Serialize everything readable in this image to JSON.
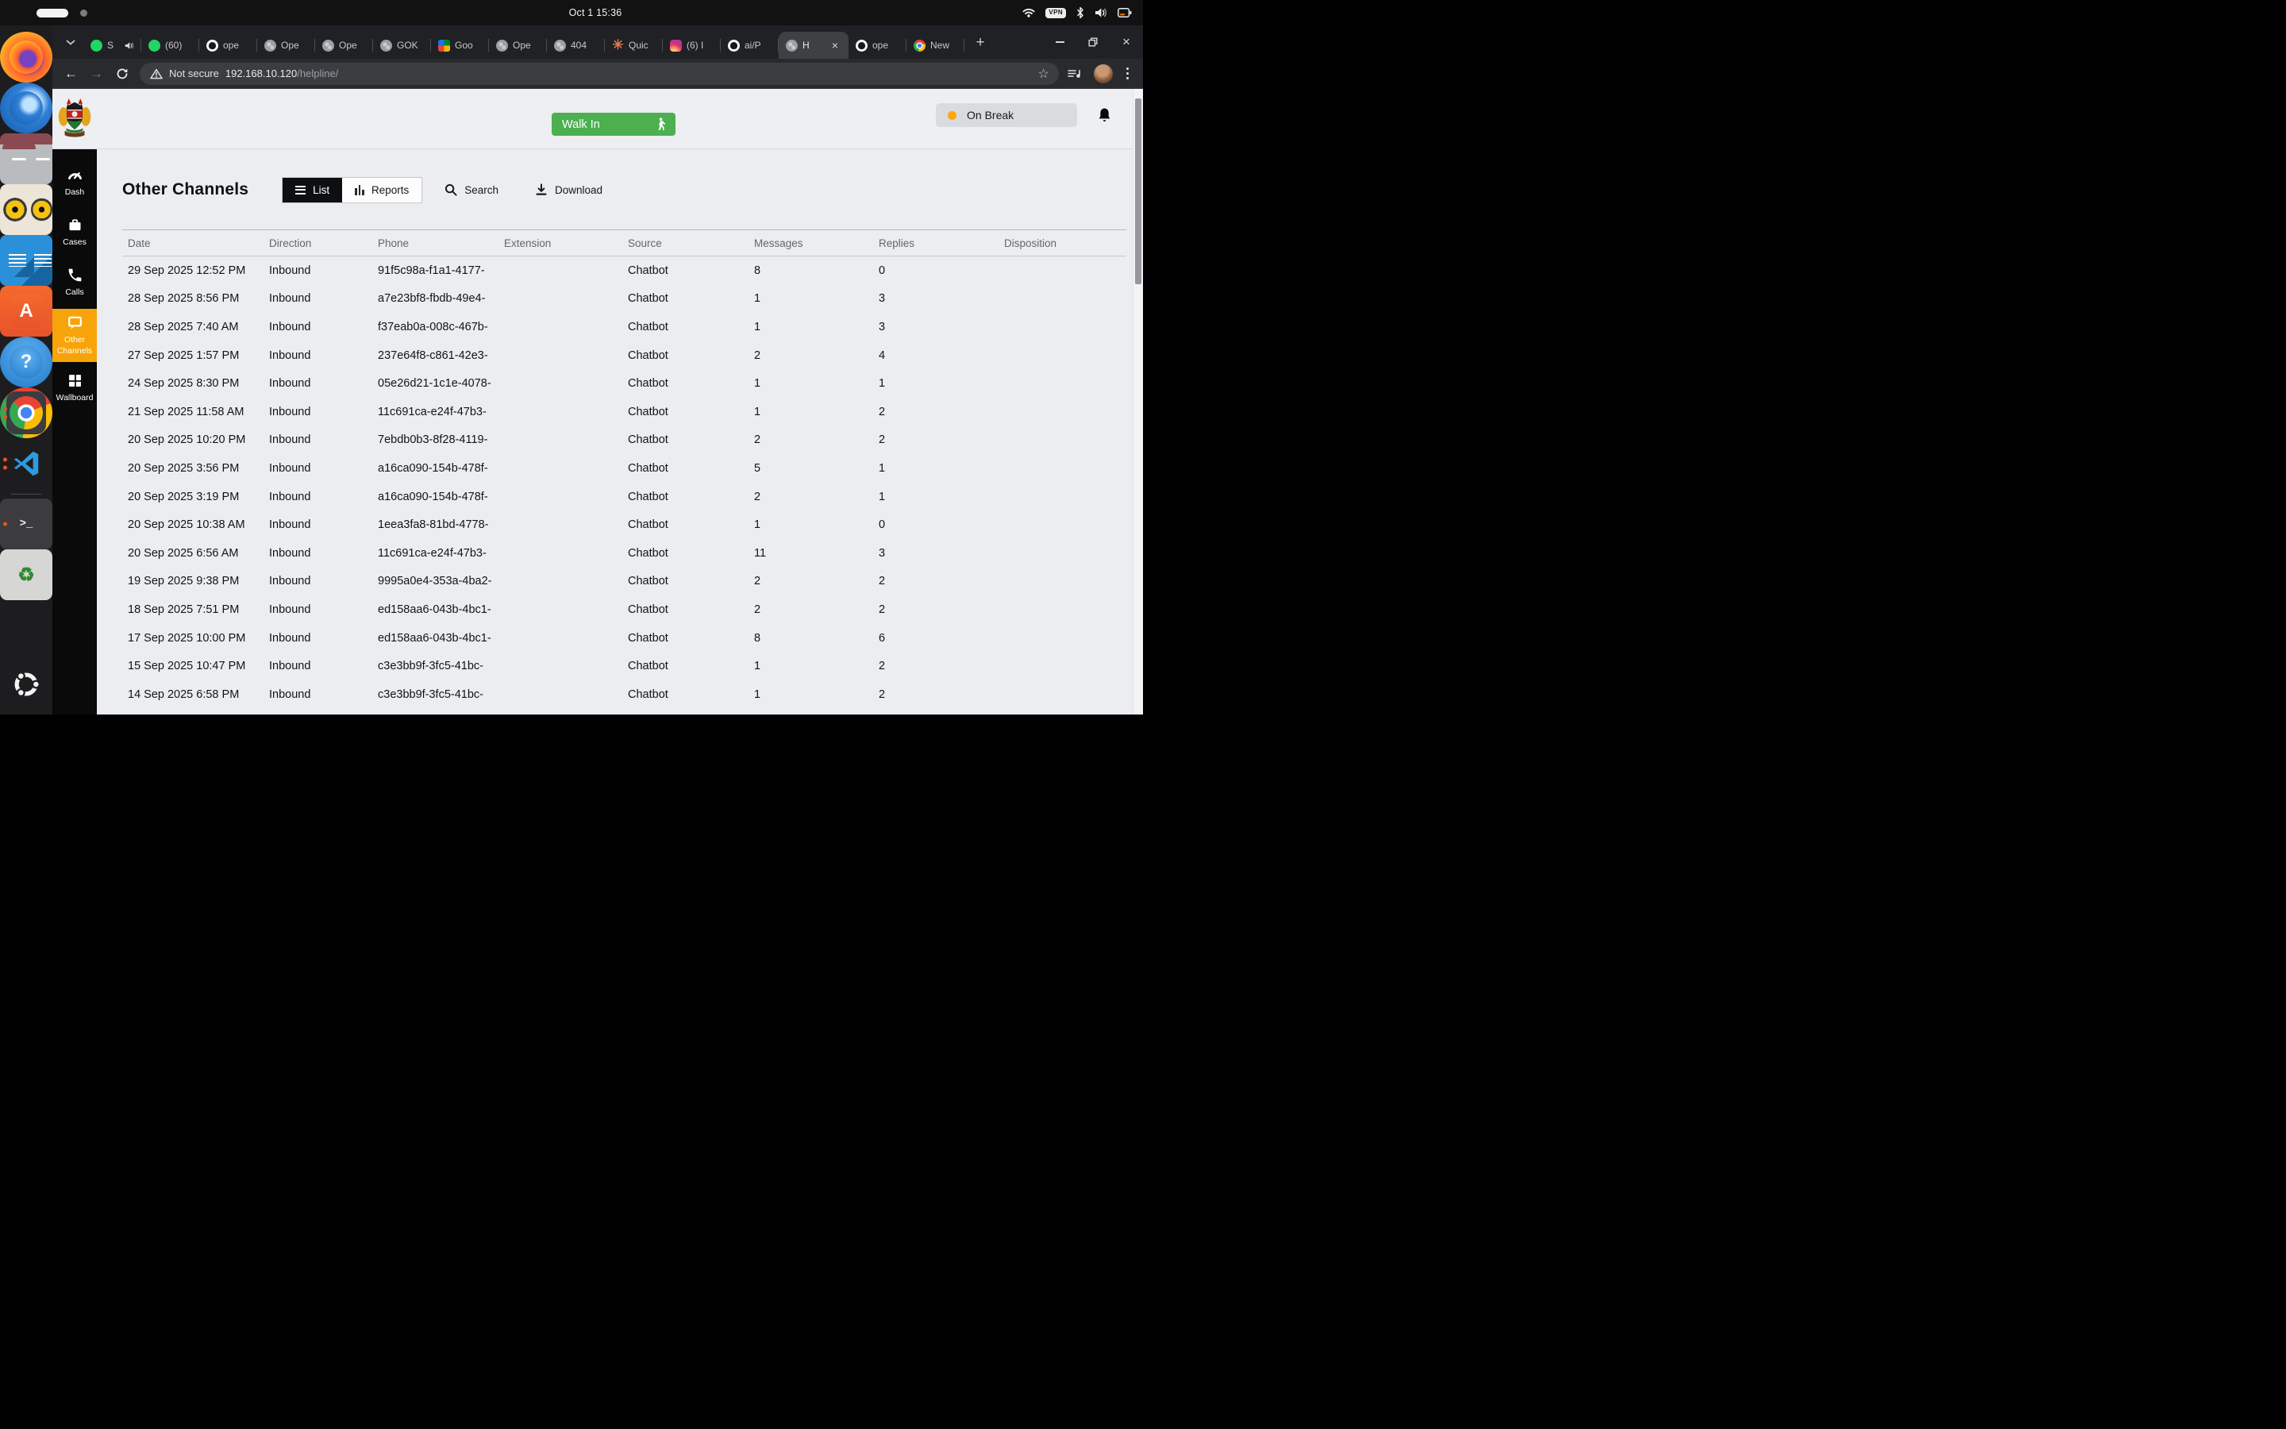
{
  "colors": {
    "accent_orange": "#F7A40A",
    "walkin_green": "#4CAF50",
    "status_dot_orange": "#FFA60A",
    "dock_running_dot": "#E95420"
  },
  "system_bar": {
    "clock": "Oct 1 15:36",
    "vpn_label": "VPN"
  },
  "dock": {
    "items": [
      {
        "name": "Firefox",
        "icon": "firefox",
        "icon_name": "firefox-icon",
        "dots": 0,
        "glyph": ""
      },
      {
        "name": "Thunderbird",
        "icon": "thunderbird",
        "icon_name": "thunderbird-icon",
        "dots": 0,
        "glyph": ""
      },
      {
        "name": "Files",
        "icon": "files",
        "icon_name": "files-icon",
        "dots": 1,
        "glyph": ""
      },
      {
        "name": "Rhythmbox",
        "icon": "rhythmbox",
        "icon_name": "rhythmbox-icon",
        "dots": 0,
        "glyph": ""
      },
      {
        "name": "LibreOffice",
        "icon": "libreoffice",
        "icon_name": "libreoffice-writer-icon",
        "dots": 0,
        "glyph": ""
      },
      {
        "name": "App Center",
        "icon": "appcenter",
        "icon_name": "app-center-icon",
        "dots": 0,
        "glyph": "A"
      },
      {
        "name": "Help",
        "icon": "help",
        "icon_name": "help-icon",
        "dots": 0,
        "glyph": "?"
      },
      {
        "name": "Google Chrome",
        "icon": "chrome",
        "icon_name": "chrome-icon",
        "dots": 2,
        "active": true,
        "glyph": ""
      },
      {
        "name": "VS Code",
        "icon": "vscode",
        "icon_name": "vscode-icon",
        "dots": 2,
        "glyph": ""
      },
      {
        "icon": "divider",
        "icon_name": "dock-divider",
        "glyph": ""
      },
      {
        "name": "Terminal",
        "icon": "terminal",
        "icon_name": "terminal-icon",
        "dots": 1,
        "glyph": ">_"
      },
      {
        "name": "Trash",
        "icon": "trash",
        "icon_name": "trash-icon",
        "dots": 0,
        "glyph": "♻"
      },
      {
        "name": "Ubuntu",
        "icon": "ubuntu",
        "icon_name": "ubuntu-logo-icon",
        "dots": 0,
        "push": true,
        "glyph": ""
      }
    ]
  },
  "browser": {
    "tabs": [
      {
        "icon": "spotify",
        "icon_name": "spotify-icon",
        "label": "S",
        "audio": true
      },
      {
        "icon": "whatsapp",
        "icon_name": "whatsapp-icon",
        "label": "(60)"
      },
      {
        "icon": "github",
        "icon_name": "github-icon",
        "label": "ope"
      },
      {
        "icon": "globe",
        "icon_name": "globe-icon",
        "label": "Ope"
      },
      {
        "icon": "globe",
        "icon_name": "globe-icon",
        "label": "Ope"
      },
      {
        "icon": "globe",
        "icon_name": "globe-icon",
        "label": "GOK"
      },
      {
        "icon": "meet",
        "icon_name": "google-meet-icon",
        "label": "Goo"
      },
      {
        "icon": "globe",
        "icon_name": "globe-icon",
        "label": "Ope"
      },
      {
        "icon": "globe",
        "icon_name": "globe-icon",
        "label": "404"
      },
      {
        "icon": "claude",
        "icon_name": "claude-icon",
        "label": "Quic",
        "glyph": "✳"
      },
      {
        "icon": "instagram",
        "icon_name": "instagram-icon",
        "label": "(6) I"
      },
      {
        "icon": "github",
        "icon_name": "github-icon",
        "label": "ai/P"
      },
      {
        "icon": "globe",
        "icon_name": "globe-icon",
        "label": "H",
        "active": true,
        "closable": true
      },
      {
        "icon": "github",
        "icon_name": "github-icon",
        "label": "ope"
      },
      {
        "icon": "chrome",
        "icon_name": "chrome-icon",
        "label": "New"
      }
    ],
    "new_tab_label": "+",
    "toolbar": {
      "not_secure_label": "Not secure",
      "url_host": "192.168.10.120",
      "url_path": "/helpline/"
    }
  },
  "app": {
    "header": {
      "walk_in_label": "Walk In",
      "status_label": "On Break"
    },
    "sidebar": {
      "items": [
        {
          "label": "Dash",
          "icon_ref": "#i-dash",
          "icon_name": "dashboard-icon"
        },
        {
          "label": "Cases",
          "icon_ref": "#i-case",
          "icon_name": "cases-icon"
        },
        {
          "label": "Calls",
          "icon_ref": "#i-phone",
          "icon_name": "calls-icon"
        },
        {
          "label": "Other Channels",
          "icon_ref": "#i-chat",
          "icon_name": "other-channels-icon",
          "active": true
        },
        {
          "label": "Wallboard",
          "icon_ref": "#i-grid",
          "icon_name": "wallboard-icon"
        }
      ]
    },
    "toolbar": {
      "title": "Other Channels",
      "list_label": "List",
      "reports_label": "Reports",
      "search_label": "Search",
      "download_label": "Download"
    },
    "table": {
      "columns": [
        "Date",
        "Direction",
        "Phone",
        "Extension",
        "Source",
        "Messages",
        "Replies",
        "Disposition"
      ],
      "rows": [
        {
          "date": "29 Sep 2025 12:52 PM",
          "direction": "Inbound",
          "phone": "91f5c98a-f1a1-4177-",
          "extension": "",
          "source": "Chatbot",
          "messages": "8",
          "replies": "0",
          "disposition": ""
        },
        {
          "date": "28 Sep 2025 8:56 PM",
          "direction": "Inbound",
          "phone": "a7e23bf8-fbdb-49e4-",
          "extension": "",
          "source": "Chatbot",
          "messages": "1",
          "replies": "3",
          "disposition": ""
        },
        {
          "date": "28 Sep 2025 7:40 AM",
          "direction": "Inbound",
          "phone": "f37eab0a-008c-467b-",
          "extension": "",
          "source": "Chatbot",
          "messages": "1",
          "replies": "3",
          "disposition": ""
        },
        {
          "date": "27 Sep 2025 1:57 PM",
          "direction": "Inbound",
          "phone": "237e64f8-c861-42e3-",
          "extension": "",
          "source": "Chatbot",
          "messages": "2",
          "replies": "4",
          "disposition": ""
        },
        {
          "date": "24 Sep 2025 8:30 PM",
          "direction": "Inbound",
          "phone": "05e26d21-1c1e-4078-",
          "extension": "",
          "source": "Chatbot",
          "messages": "1",
          "replies": "1",
          "disposition": ""
        },
        {
          "date": "21 Sep 2025 11:58 AM",
          "direction": "Inbound",
          "phone": "11c691ca-e24f-47b3-",
          "extension": "",
          "source": "Chatbot",
          "messages": "1",
          "replies": "2",
          "disposition": ""
        },
        {
          "date": "20 Sep 2025 10:20 PM",
          "direction": "Inbound",
          "phone": "7ebdb0b3-8f28-4119-",
          "extension": "",
          "source": "Chatbot",
          "messages": "2",
          "replies": "2",
          "disposition": ""
        },
        {
          "date": "20 Sep 2025 3:56 PM",
          "direction": "Inbound",
          "phone": "a16ca090-154b-478f-",
          "extension": "",
          "source": "Chatbot",
          "messages": "5",
          "replies": "1",
          "disposition": ""
        },
        {
          "date": "20 Sep 2025 3:19 PM",
          "direction": "Inbound",
          "phone": "a16ca090-154b-478f-",
          "extension": "",
          "source": "Chatbot",
          "messages": "2",
          "replies": "1",
          "disposition": ""
        },
        {
          "date": "20 Sep 2025 10:38 AM",
          "direction": "Inbound",
          "phone": "1eea3fa8-81bd-4778-",
          "extension": "",
          "source": "Chatbot",
          "messages": "1",
          "replies": "0",
          "disposition": ""
        },
        {
          "date": "20 Sep 2025 6:56 AM",
          "direction": "Inbound",
          "phone": "11c691ca-e24f-47b3-",
          "extension": "",
          "source": "Chatbot",
          "messages": "11",
          "replies": "3",
          "disposition": ""
        },
        {
          "date": "19 Sep 2025 9:38 PM",
          "direction": "Inbound",
          "phone": "9995a0e4-353a-4ba2-",
          "extension": "",
          "source": "Chatbot",
          "messages": "2",
          "replies": "2",
          "disposition": ""
        },
        {
          "date": "18 Sep 2025 7:51 PM",
          "direction": "Inbound",
          "phone": "ed158aa6-043b-4bc1-",
          "extension": "",
          "source": "Chatbot",
          "messages": "2",
          "replies": "2",
          "disposition": ""
        },
        {
          "date": "17 Sep 2025 10:00 PM",
          "direction": "Inbound",
          "phone": "ed158aa6-043b-4bc1-",
          "extension": "",
          "source": "Chatbot",
          "messages": "8",
          "replies": "6",
          "disposition": ""
        },
        {
          "date": "15 Sep 2025 10:47 PM",
          "direction": "Inbound",
          "phone": "c3e3bb9f-3fc5-41bc-",
          "extension": "",
          "source": "Chatbot",
          "messages": "1",
          "replies": "2",
          "disposition": ""
        },
        {
          "date": "14 Sep 2025 6:58 PM",
          "direction": "Inbound",
          "phone": "c3e3bb9f-3fc5-41bc-",
          "extension": "",
          "source": "Chatbot",
          "messages": "1",
          "replies": "2",
          "disposition": ""
        }
      ]
    }
  }
}
